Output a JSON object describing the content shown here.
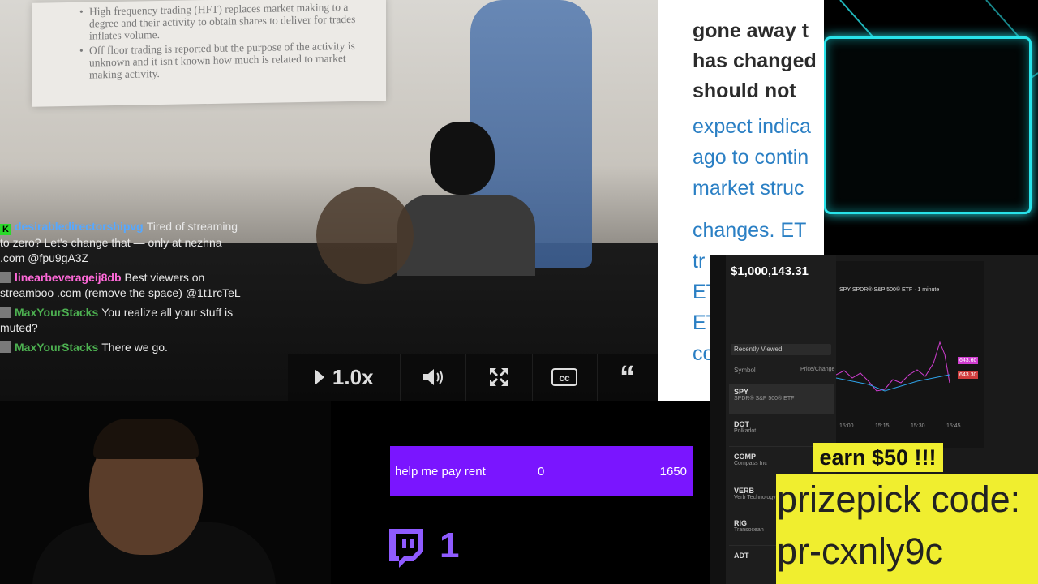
{
  "slide": {
    "bullets": [
      "High frequency trading (HFT) replaces market making to a degree and their activity to obtain shares to deliver for trades inflates volume.",
      "Off floor trading is reported but the purpose of the activity is unknown and it isn't known how much is related to market making activity."
    ]
  },
  "chat": {
    "messages": [
      {
        "user": "desirabledirectorshipvg",
        "text": "Tired of streaming to zero? Let's change that — only at nezhna .com @fpu9gA3Z",
        "color": "#56a8ff",
        "badge": "kick"
      },
      {
        "user": "linearbeverageij8db",
        "text": "Best viewers on streamboo .com (remove the space) @1t1rcTeL",
        "color": "#ff69d9",
        "badge": "twitch"
      },
      {
        "user": "MaxYourStacks",
        "text": "You realize all your stuff is muted?",
        "color": "#4caf50",
        "badge": "twitch"
      },
      {
        "user": "MaxYourStacks",
        "text": "There we go.",
        "color": "#4caf50",
        "badge": "twitch"
      }
    ]
  },
  "controls": {
    "speed": "1.0x",
    "icons": [
      "volume-icon",
      "fullscreen-icon",
      "captions-icon",
      "quote-icon"
    ]
  },
  "article": {
    "dark_lines": [
      "gone away t",
      "has changed",
      "should not"
    ],
    "blue_lines": [
      "expect indica",
      "ago to contin",
      "market struc",
      "changes. ET",
      "tr",
      "ET",
      "ET",
      "co"
    ]
  },
  "trading": {
    "balance": "$1,000,143.31",
    "list_header": "Recently Viewed",
    "col_symbol": "Symbol",
    "col_price": "Price/Change %",
    "rows": [
      {
        "ticker": "SPY",
        "name": "SPDR® S&P 500® ETF"
      },
      {
        "ticker": "DOT",
        "name": "Polkadot"
      },
      {
        "ticker": "COMP",
        "name": "Compass Inc"
      },
      {
        "ticker": "VERB",
        "name": "Verb Technology Co Inc"
      },
      {
        "ticker": "RIG",
        "name": "Transocean"
      },
      {
        "ticker": "ADT",
        "name": ""
      }
    ],
    "chart_title": "SPY  SPDR® S&P 500® ETF · 1 minute",
    "price_high": "643.60",
    "price_low": "643.30",
    "times": [
      "15:00",
      "15:15",
      "15:30",
      "15:45"
    ]
  },
  "goal": {
    "label": "help me pay rent",
    "current": "0",
    "target": "1650"
  },
  "twitch_count": "1",
  "promo": {
    "earn": "earn $50 !!!",
    "line1": "prizepick code:",
    "line2": "pr-cxnly9c"
  },
  "colors": {
    "goal_bar": "#7a15ff",
    "promo_bg": "#f0ee2f",
    "neon": "#28e3ea",
    "article_blue": "#2a7fc4"
  }
}
